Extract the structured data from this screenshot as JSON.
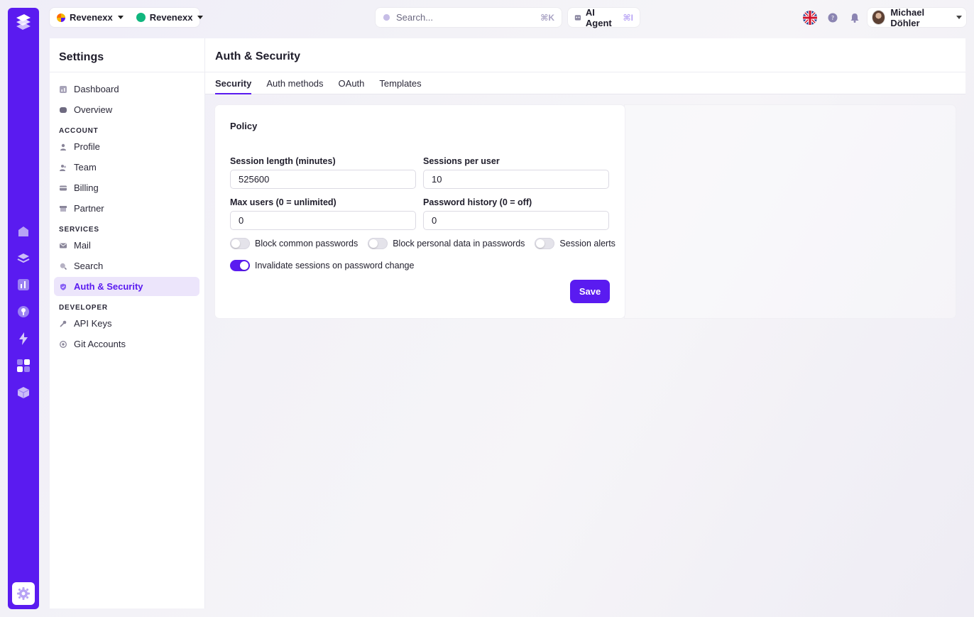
{
  "topbar": {
    "org1": "Revenexx",
    "org2": "Revenexx",
    "search_placeholder": "Search...",
    "search_shortcut": "⌘K",
    "agent_label": "AI Agent",
    "agent_shortcut": "⌘I",
    "user_name": "Michael Döhler"
  },
  "sidebar": {
    "title": "Settings",
    "items_top": [
      {
        "label": "Dashboard",
        "icon": "chart-icon"
      },
      {
        "label": "Overview",
        "icon": "overview-icon"
      }
    ],
    "account_label": "ACCOUNT",
    "account_items": [
      {
        "label": "Profile",
        "icon": "person-icon"
      },
      {
        "label": "Team",
        "icon": "team-icon"
      },
      {
        "label": "Billing",
        "icon": "card-icon"
      },
      {
        "label": "Partner",
        "icon": "store-icon"
      }
    ],
    "services_label": "SERVICES",
    "services_items": [
      {
        "label": "Mail",
        "icon": "mail-icon"
      },
      {
        "label": "Search",
        "icon": "search-icon"
      },
      {
        "label": "Auth & Security",
        "icon": "shield-icon",
        "active": true
      }
    ],
    "developer_label": "DEVELOPER",
    "developer_items": [
      {
        "label": "API Keys",
        "icon": "key-icon"
      },
      {
        "label": "Git Accounts",
        "icon": "at-icon"
      }
    ]
  },
  "main": {
    "title": "Auth & Security",
    "tabs": [
      "Security",
      "Auth methods",
      "OAuth",
      "Templates"
    ],
    "active_tab": "Security"
  },
  "policy": {
    "heading": "Policy",
    "session_length_label": "Session length (minutes)",
    "session_length_value": "525600",
    "sessions_per_user_label": "Sessions per user",
    "sessions_per_user_value": "10",
    "max_users_label": "Max users (0 = unlimited)",
    "max_users_value": "0",
    "password_history_label": "Password history (0 = off)",
    "password_history_value": "0",
    "toggles": [
      {
        "label": "Block common passwords",
        "on": false
      },
      {
        "label": "Block personal data in passwords",
        "on": false
      },
      {
        "label": "Session alerts",
        "on": false
      },
      {
        "label": "Invalidate sessions on password change",
        "on": true
      }
    ],
    "save_label": "Save"
  },
  "colors": {
    "brand": "#5a1bf0",
    "active_bg": "#ece5fb",
    "org2_dot": "#10b67e"
  }
}
